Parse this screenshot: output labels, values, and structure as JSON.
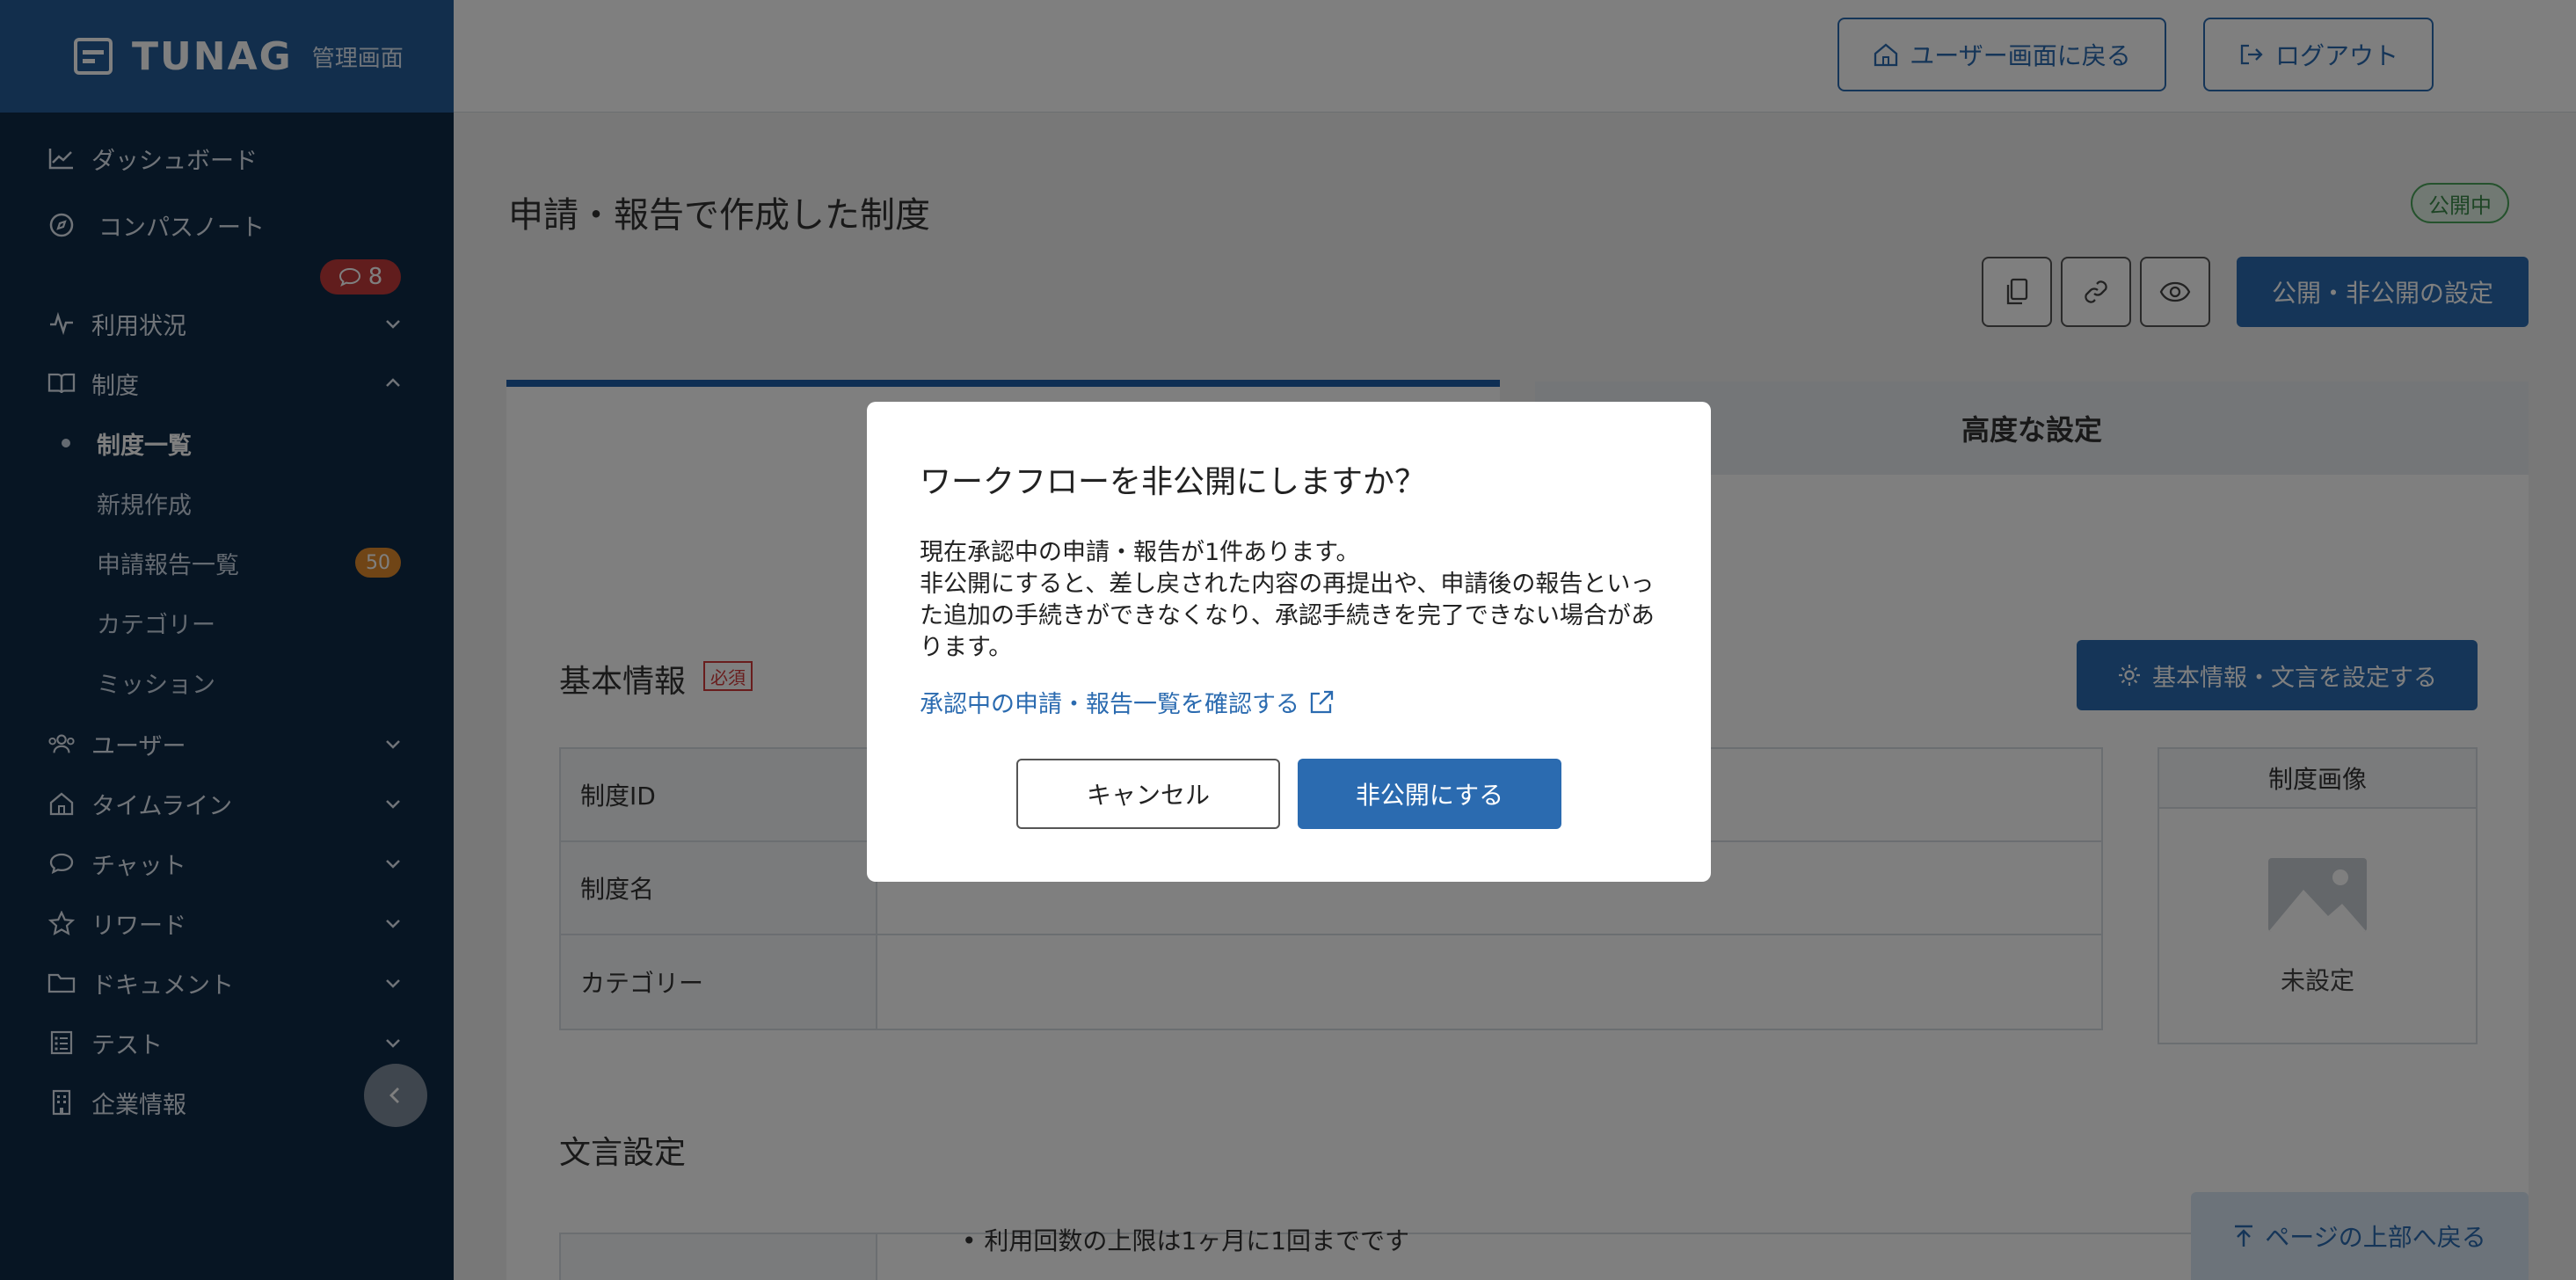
{
  "sidebar": {
    "brand": "TUNAG",
    "brand_sub": "管理画面",
    "chat_badge": "8",
    "items": {
      "dashboard": "ダッシュボード",
      "compass": "コンパスノート",
      "usage": "利用状況",
      "system": "制度",
      "system_list": "制度一覧",
      "new": "新規作成",
      "reports": "申請報告一覧",
      "reports_count": "50",
      "category": "カテゴリー",
      "mission": "ミッション",
      "users": "ユーザー",
      "timeline": "タイムライン",
      "chat": "チャット",
      "reward": "リワード",
      "document": "ドキュメント",
      "test": "テスト",
      "company": "企業情報"
    }
  },
  "header": {
    "user_screen": "ユーザー画面に戻る",
    "logout": "ログアウト"
  },
  "main": {
    "title": "申請・報告で作成した制度",
    "status": "公開中",
    "publish_button": "公開・非公開の設定",
    "tab_advanced": "高度な設定",
    "basic_info": "基本情報",
    "required": "必須",
    "basic_settings_button": "基本情報・文言を設定する",
    "table": [
      {
        "key": "制度ID"
      },
      {
        "key": "制度名"
      },
      {
        "key": "カテゴリー"
      }
    ],
    "image_title": "制度画像",
    "image_status": "未設定",
    "text_settings": "文言設定",
    "bullet": "利用回数の上限は1ヶ月に1回までです",
    "to_top": "ページの上部へ戻る"
  },
  "modal": {
    "title": "ワークフローを非公開にしますか？",
    "body_line1": "現在承認中の申請・報告が1件あります。",
    "body_line2": "非公開にすると、差し戻された内容の再提出や、申請後の報告といった追加の手続きができなくなり、承認手続きを完了できない場合があります。",
    "link": "承認中の申請・報告一覧を確認する",
    "cancel": "キャンセル",
    "confirm": "非公開にする"
  },
  "colors": {
    "sidebar_bg": "#0f2a47",
    "brand_bg": "#255d99",
    "accent": "#2b6bb0",
    "badge_red": "#c23a3a",
    "badge_orange": "#e08b2c",
    "status_green": "#4aa55a"
  }
}
